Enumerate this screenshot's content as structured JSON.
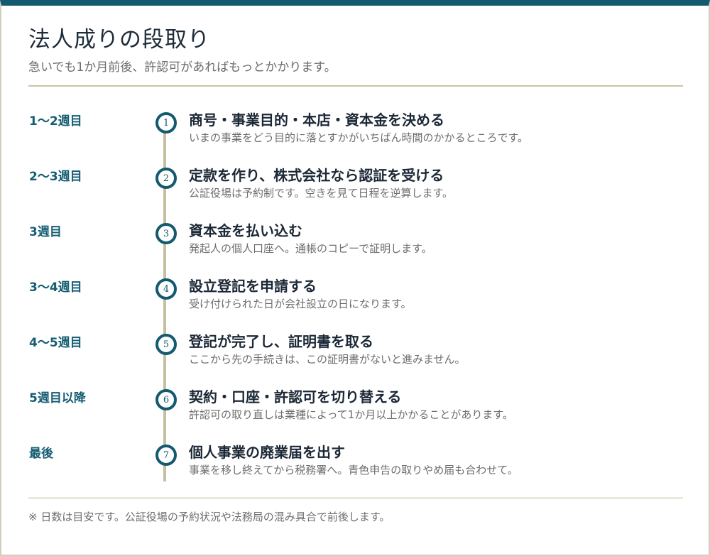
{
  "header": {
    "title": "法人成りの段取り",
    "subtitle": "急いでも1か月前後、許認可があればもっとかかります。"
  },
  "steps": [
    {
      "week": "1〜2週目",
      "marker": "1",
      "title": "商号・事業目的・本店・資本金を決める",
      "desc": "いまの事業をどう目的に落とすかがいちばん時間のかかるところです。"
    },
    {
      "week": "2〜3週目",
      "marker": "2",
      "title": "定款を作り、株式会社なら認証を受ける",
      "desc": "公証役場は予約制です。空きを見て日程を逆算します。"
    },
    {
      "week": "3週目",
      "marker": "3",
      "title": "資本金を払い込む",
      "desc": "発起人の個人口座へ。通帳のコピーで証明します。"
    },
    {
      "week": "3〜4週目",
      "marker": "4",
      "title": "設立登記を申請する",
      "desc": "受け付けられた日が会社設立の日になります。"
    },
    {
      "week": "4〜5週目",
      "marker": "5",
      "title": "登記が完了し、証明書を取る",
      "desc": "ここから先の手続きは、この証明書がないと進みません。"
    },
    {
      "week": "5週目以降",
      "marker": "6",
      "title": "契約・口座・許認可を切り替える",
      "desc": "許認可の取り直しは業種によって1か月以上かかることがあります。"
    },
    {
      "week": "最後",
      "marker": "7",
      "title": "個人事業の廃業届を出す",
      "desc": "事業を移し終えてから税務署へ。青色申告の取りやめ届も合わせて。"
    }
  ],
  "footer": {
    "note": "※ 日数は目安です。公証役場の予約状況や法務局の混み具合で前後します。"
  },
  "colors": {
    "accent": "#145a6f",
    "rail": "#c6bf9f",
    "rule": "#cbc4a6"
  }
}
